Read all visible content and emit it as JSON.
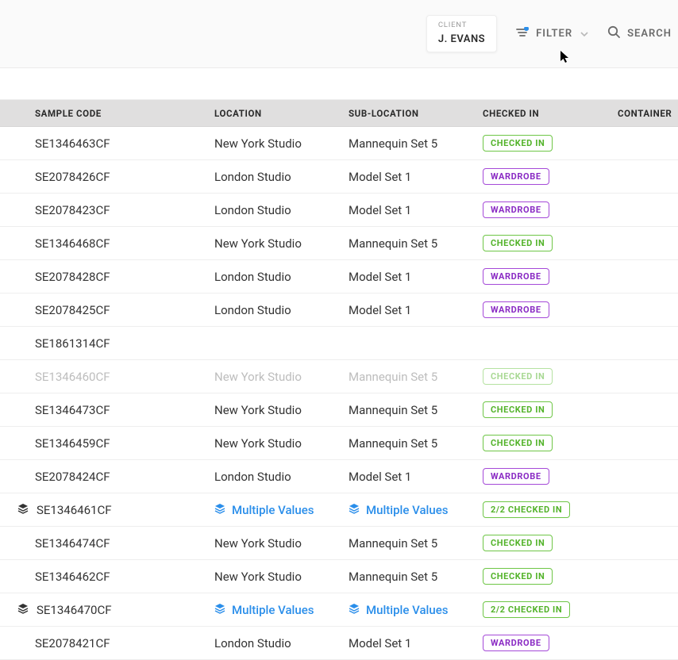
{
  "toolbar": {
    "client_label": "CLIENT",
    "client_name": "J. EVANS",
    "filter_label": "FILTER",
    "search_label": "SEARCH"
  },
  "columns": {
    "sample": "SAMPLE CODE",
    "location": "LOCATION",
    "sublocation": "SUB-LOCATION",
    "status": "CHECKED IN",
    "container": "CONTAINER"
  },
  "multiple_values_label": "Multiple Values",
  "badges": {
    "checked_in": "CHECKED IN",
    "wardrobe": "WARDROBE",
    "two_two": "2/2 CHECKED IN"
  },
  "rows": [
    {
      "code": "SE1346463CF",
      "location": "New York Studio",
      "sublocation": "Mannequin Set 5",
      "status": "checked_in",
      "stacked": false,
      "faded": false
    },
    {
      "code": "SE2078426CF",
      "location": "London Studio",
      "sublocation": "Model Set 1",
      "status": "wardrobe",
      "stacked": false,
      "faded": false
    },
    {
      "code": "SE2078423CF",
      "location": "London Studio",
      "sublocation": "Model Set 1",
      "status": "wardrobe",
      "stacked": false,
      "faded": false
    },
    {
      "code": "SE1346468CF",
      "location": "New York Studio",
      "sublocation": "Mannequin Set 5",
      "status": "checked_in",
      "stacked": false,
      "faded": false
    },
    {
      "code": "SE2078428CF",
      "location": "London Studio",
      "sublocation": "Model Set 1",
      "status": "wardrobe",
      "stacked": false,
      "faded": false
    },
    {
      "code": "SE2078425CF",
      "location": "London Studio",
      "sublocation": "Model Set 1",
      "status": "wardrobe",
      "stacked": false,
      "faded": false
    },
    {
      "code": "SE1861314CF",
      "location": "",
      "sublocation": "",
      "status": null,
      "stacked": false,
      "faded": false
    },
    {
      "code": "SE1346460CF",
      "location": "New York Studio",
      "sublocation": "Mannequin Set 5",
      "status": "checked_in",
      "stacked": false,
      "faded": true
    },
    {
      "code": "SE1346473CF",
      "location": "New York Studio",
      "sublocation": "Mannequin Set 5",
      "status": "checked_in",
      "stacked": false,
      "faded": false
    },
    {
      "code": "SE1346459CF",
      "location": "New York Studio",
      "sublocation": "Mannequin Set 5",
      "status": "checked_in",
      "stacked": false,
      "faded": false
    },
    {
      "code": "SE2078424CF",
      "location": "London Studio",
      "sublocation": "Model Set 1",
      "status": "wardrobe",
      "stacked": false,
      "faded": false
    },
    {
      "code": "SE1346461CF",
      "location": "MULTI",
      "sublocation": "MULTI",
      "status": "two_two",
      "stacked": true,
      "faded": false
    },
    {
      "code": "SE1346474CF",
      "location": "New York Studio",
      "sublocation": "Mannequin Set 5",
      "status": "checked_in",
      "stacked": false,
      "faded": false
    },
    {
      "code": "SE1346462CF",
      "location": "New York Studio",
      "sublocation": "Mannequin Set 5",
      "status": "checked_in",
      "stacked": false,
      "faded": false
    },
    {
      "code": "SE1346470CF",
      "location": "MULTI",
      "sublocation": "MULTI",
      "status": "two_two",
      "stacked": true,
      "faded": false
    },
    {
      "code": "SE2078421CF",
      "location": "London Studio",
      "sublocation": "Model Set 1",
      "status": "wardrobe",
      "stacked": false,
      "faded": false
    }
  ]
}
